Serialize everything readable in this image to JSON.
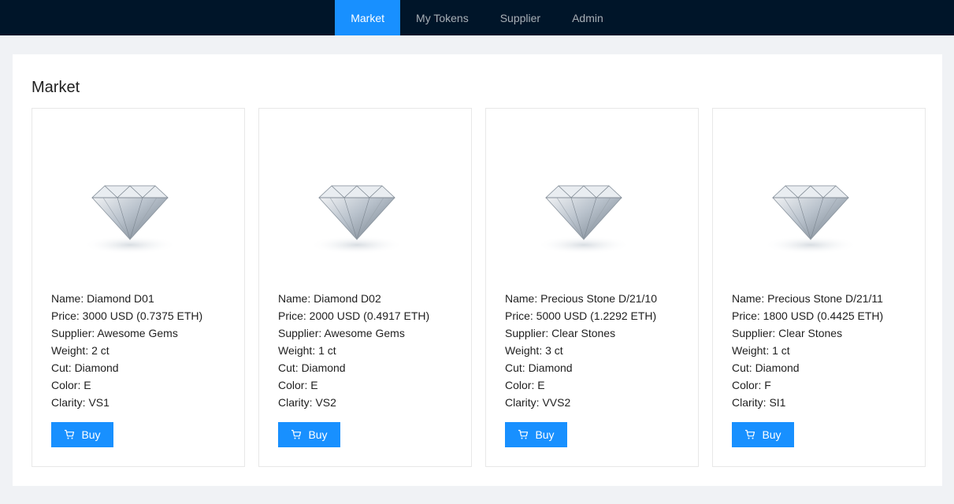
{
  "nav": {
    "items": [
      {
        "label": "Market",
        "active": true
      },
      {
        "label": "My Tokens",
        "active": false
      },
      {
        "label": "Supplier",
        "active": false
      },
      {
        "label": "Admin",
        "active": false
      }
    ]
  },
  "page": {
    "title": "Market"
  },
  "colors": {
    "accent": "#1890ff",
    "header": "#001529"
  },
  "products": [
    {
      "name": "Name: Diamond D01",
      "price": "Price: 3000 USD (0.7375 ETH)",
      "supplier": "Supplier: Awesome Gems",
      "weight": "Weight: 2 ct",
      "cut": "Cut: Diamond",
      "color": "Color: E",
      "clarity": "Clarity: VS1",
      "buy_label": "Buy",
      "icon": "cart-icon"
    },
    {
      "name": "Name: Diamond D02",
      "price": "Price: 2000 USD (0.4917 ETH)",
      "supplier": "Supplier: Awesome Gems",
      "weight": "Weight: 1 ct",
      "cut": "Cut: Diamond",
      "color": "Color: E",
      "clarity": "Clarity: VS2",
      "buy_label": "Buy",
      "icon": "cart-icon"
    },
    {
      "name": "Name: Precious Stone D/21/10",
      "price": "Price: 5000 USD (1.2292 ETH)",
      "supplier": "Supplier: Clear Stones",
      "weight": "Weight: 3 ct",
      "cut": "Cut: Diamond",
      "color": "Color: E",
      "clarity": "Clarity: VVS2",
      "buy_label": "Buy",
      "icon": "cart-icon"
    },
    {
      "name": "Name: Precious Stone D/21/11",
      "price": "Price: 1800 USD (0.4425 ETH)",
      "supplier": "Supplier: Clear Stones",
      "weight": "Weight: 1 ct",
      "cut": "Cut: Diamond",
      "color": "Color: F",
      "clarity": "Clarity: SI1",
      "buy_label": "Buy",
      "icon": "cart-icon"
    }
  ]
}
